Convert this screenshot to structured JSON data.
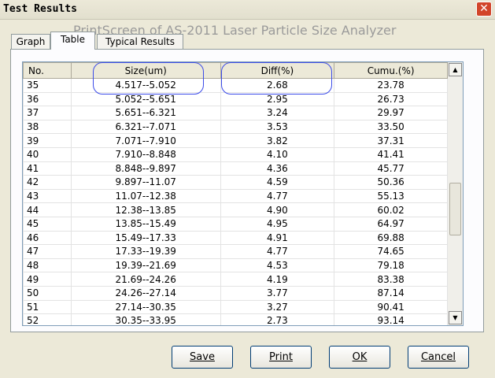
{
  "window": {
    "title": "Test Results",
    "close_glyph": "✕"
  },
  "watermark": "PrintScreen of AS-2011 Laser Particle Size Analyzer",
  "tabs": [
    {
      "label": "Graph"
    },
    {
      "label": "Table"
    },
    {
      "label": "Typical Results"
    }
  ],
  "active_tab": "Table",
  "table": {
    "columns": [
      "No.",
      "Size(um)",
      "Diff(%)",
      "Cumu.(%)"
    ],
    "rows": [
      [
        "35",
        "4.517--5.052",
        "2.68",
        "23.78"
      ],
      [
        "36",
        "5.052--5.651",
        "2.95",
        "26.73"
      ],
      [
        "37",
        "5.651--6.321",
        "3.24",
        "29.97"
      ],
      [
        "38",
        "6.321--7.071",
        "3.53",
        "33.50"
      ],
      [
        "39",
        "7.071--7.910",
        "3.82",
        "37.31"
      ],
      [
        "40",
        "7.910--8.848",
        "4.10",
        "41.41"
      ],
      [
        "41",
        "8.848--9.897",
        "4.36",
        "45.77"
      ],
      [
        "42",
        "9.897--11.07",
        "4.59",
        "50.36"
      ],
      [
        "43",
        "11.07--12.38",
        "4.77",
        "55.13"
      ],
      [
        "44",
        "12.38--13.85",
        "4.90",
        "60.02"
      ],
      [
        "45",
        "13.85--15.49",
        "4.95",
        "64.97"
      ],
      [
        "46",
        "15.49--17.33",
        "4.91",
        "69.88"
      ],
      [
        "47",
        "17.33--19.39",
        "4.77",
        "74.65"
      ],
      [
        "48",
        "19.39--21.69",
        "4.53",
        "79.18"
      ],
      [
        "49",
        "21.69--24.26",
        "4.19",
        "83.38"
      ],
      [
        "50",
        "24.26--27.14",
        "3.77",
        "87.14"
      ],
      [
        "51",
        "27.14--30.35",
        "3.27",
        "90.41"
      ],
      [
        "52",
        "30.35--33.95",
        "2.73",
        "93.14"
      ]
    ]
  },
  "scrollbar": {
    "up_icon": "▲",
    "down_icon": "▼"
  },
  "buttons": {
    "save": "Save",
    "print": "Print",
    "ok": "OK",
    "cancel": "Cancel"
  },
  "colors": {
    "highlight": "#3B4BE8",
    "close_button": "#D2452A"
  }
}
